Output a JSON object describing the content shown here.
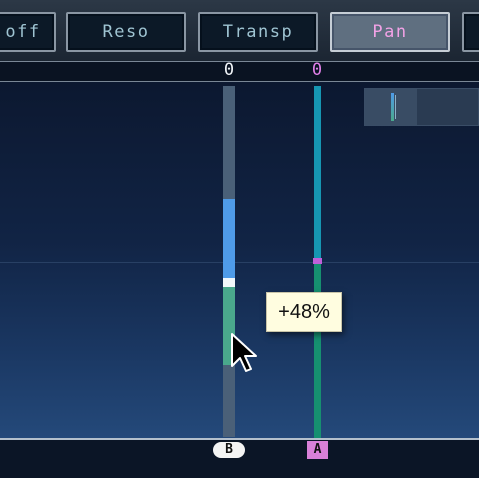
{
  "toolbar": {
    "tabs": [
      {
        "label": "off",
        "selected": false
      },
      {
        "label": "Reso",
        "selected": false
      },
      {
        "label": "Transp",
        "selected": false
      },
      {
        "label": "Pan",
        "selected": true
      },
      {
        "label": "",
        "selected": false
      }
    ]
  },
  "ruler": {
    "b_value_label": "0",
    "a_value_label": "0"
  },
  "sliders": {
    "b": {
      "label": "B",
      "value_percent": 48
    },
    "a": {
      "label": "A"
    }
  },
  "tooltip": {
    "text": "+48%"
  },
  "colors": {
    "selected_tab_text": "#f2a2e6",
    "tab_text": "#9fc4d2",
    "b_upper": "#4f9be8",
    "b_lower": "#4aa88c",
    "a_upper": "#1696b2",
    "a_lower": "#169070",
    "a_marker": "#c060d8",
    "a_badge": "#d880d8"
  },
  "icons": {
    "cursor": "arrow-cursor-icon"
  }
}
